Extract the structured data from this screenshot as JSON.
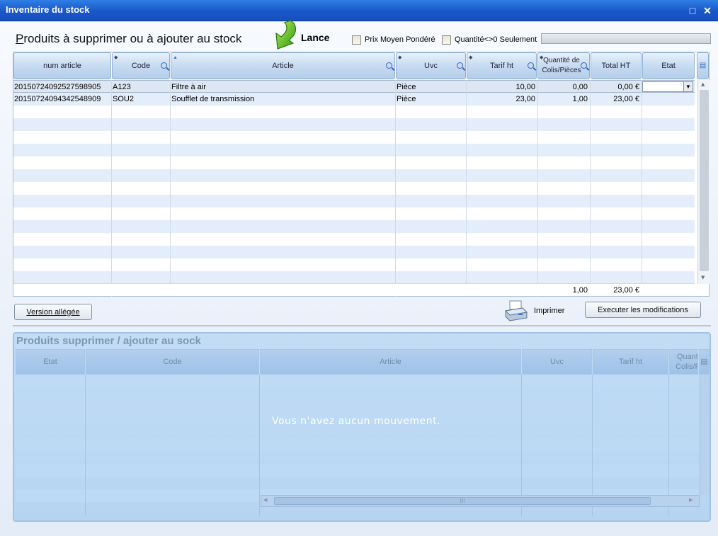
{
  "window": {
    "title": "Inventaire du stock",
    "controls": {
      "maximize": "□",
      "close": "✕"
    }
  },
  "toolbar": {
    "title": "Produits à supprimer ou à ajouter au stock",
    "lance_label": "Lance",
    "checkbox_pmp": {
      "label": "Prix Moyen Pondéré",
      "checked": false
    },
    "checkbox_qty": {
      "label": "Quantité<>0 Seulement",
      "checked": false
    }
  },
  "grid": {
    "columns": [
      "num article",
      "Code",
      "Article",
      "Uvc",
      "Tarif ht",
      "Quantité de Colis/Pièces",
      "Total HT",
      "Etat"
    ],
    "rows": [
      {
        "num": "20150724092527598905",
        "code": "A123",
        "article": "Filtre à air",
        "uvc": "Pièce",
        "tarif": "10,00",
        "qty": "0,00",
        "total": "0,00 €",
        "etat": ""
      },
      {
        "num": "20150724094342548909",
        "code": "SOU2",
        "article": "Soufflet de transmission",
        "uvc": "Pièce",
        "tarif": "23,00",
        "qty": "1,00",
        "total": "23,00 €",
        "etat": ""
      }
    ],
    "footer": {
      "qty_total": "1,00",
      "total": "23,00 €"
    }
  },
  "actions": {
    "version_allegee": "Version allégée",
    "imprimer": "Imprimer",
    "executer": "Executer les modifications"
  },
  "panel": {
    "title": "Produits supprimer / ajouter au sock",
    "columns": [
      "Etat",
      "Code",
      "Article",
      "Uvc",
      "Tarif ht",
      "Quantité de Colis/Pièces"
    ],
    "empty_message": "Vous n'avez aucun mouvement.",
    "hscroll_grip": "III"
  }
}
